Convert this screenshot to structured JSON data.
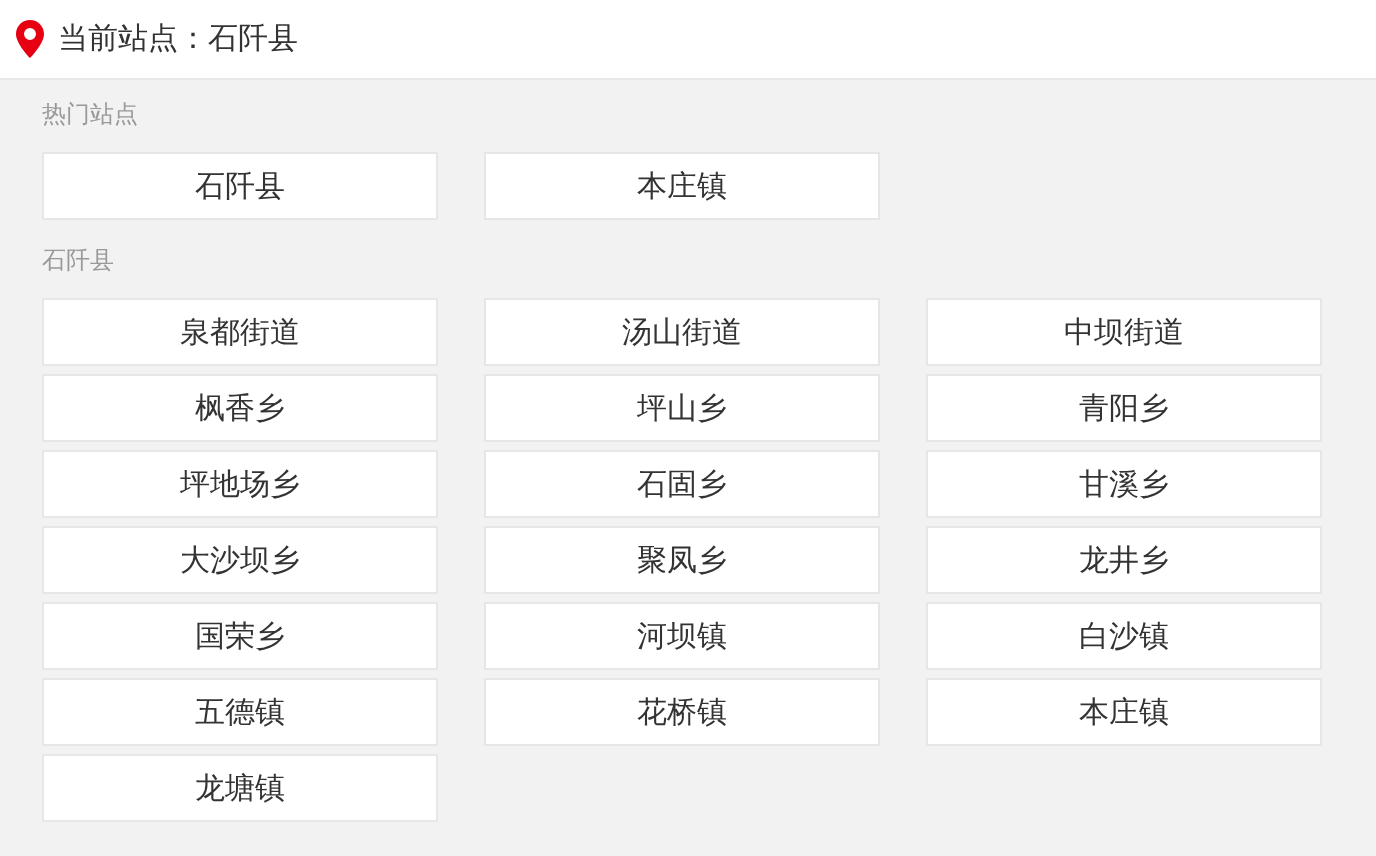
{
  "header": {
    "text": "当前站点：石阡县"
  },
  "sections": [
    {
      "title": "热门站点",
      "stations": [
        "石阡县",
        "本庄镇"
      ]
    },
    {
      "title": "石阡县",
      "stations": [
        "泉都街道",
        "汤山街道",
        "中坝街道",
        "枫香乡",
        "坪山乡",
        "青阳乡",
        "坪地场乡",
        "石固乡",
        "甘溪乡",
        "大沙坝乡",
        "聚凤乡",
        "龙井乡",
        "国荣乡",
        "河坝镇",
        "白沙镇",
        "五德镇",
        "花桥镇",
        "本庄镇",
        "龙塘镇"
      ]
    }
  ]
}
